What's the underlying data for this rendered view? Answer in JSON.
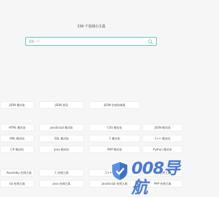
{
  "header": {
    "title": "156 个在线小工具"
  },
  "search": {
    "placeholder": "搜索一下"
  },
  "cards": [
    "JSON 格式化",
    "JSON 验证",
    "JSON 生成实体类",
    "HTML 格式化",
    "JavaScript 格式化",
    "CSS 格式化",
    "JSON 格式化",
    "XML 格式化",
    "SQL 格式化",
    "C 格式化",
    "C++ 格式化",
    "C# 格式化",
    "Java 格式化",
    "PHP 格式化",
    "Python 格式化",
    "Assembly 在线工具",
    "C 在线工具",
    "C++ 在线工具",
    "C# 在线工具",
    "Go 在线工具",
    "Java 在线工具",
    "JavaScript 在线工具",
    "PHP 在线工具"
  ],
  "watermark": {
    "text": "008导航",
    "icon": "shield-logo-icon"
  }
}
